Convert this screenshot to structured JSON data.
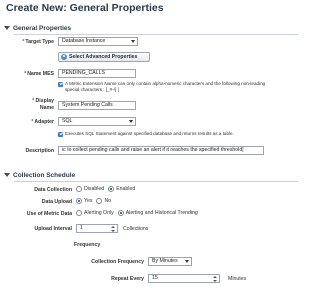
{
  "page": {
    "title": "Create New: General Properties"
  },
  "general": {
    "header": "General Properties",
    "target_type": {
      "label": "Target Type",
      "value": "Database Instance"
    },
    "select_adv_button": "Select Advanced Properties",
    "name_mes": {
      "label": "Name MES",
      "value": "PENDING_CALLS",
      "note": "A Metric Extension Name can only contain alpha-numeric characters and the following non-leading special characters : [_#-/] ]"
    },
    "display_name": {
      "label_line1": "Display",
      "label_line2": "Name",
      "value": "System Pending Calls"
    },
    "adapter": {
      "label": "Adapter",
      "value": "SQL",
      "note": "Executes SQL Statement against specified database and returns results as a table."
    },
    "description": {
      "label": "Description",
      "value": "ic to collect pending calls and raise an alert if it reaches the specified threshold|"
    }
  },
  "schedule": {
    "header": "Collection Schedule",
    "data_collection": {
      "label": "Data Collection",
      "options": [
        "Disabled",
        "Enabled"
      ],
      "selected": "Enabled"
    },
    "data_upload": {
      "label": "Data Upload",
      "options": [
        "Yes",
        "No"
      ],
      "selected": "Yes"
    },
    "metric_data": {
      "label": "Use of Metric Data",
      "options": [
        "Alerting Only",
        "Alerting and Historical Trending"
      ],
      "selected": "Alerting and Historical Trending"
    },
    "upload_interval": {
      "label": "Upload Interval",
      "value": "1",
      "unit": "Collections"
    },
    "frequency": {
      "heading": "Frequency",
      "collection_frequency": {
        "label": "Collection Frequency",
        "value": "By Minutes"
      },
      "repeat_every": {
        "label": "Repeat Every",
        "value": "15",
        "unit": "Minutes"
      }
    }
  }
}
